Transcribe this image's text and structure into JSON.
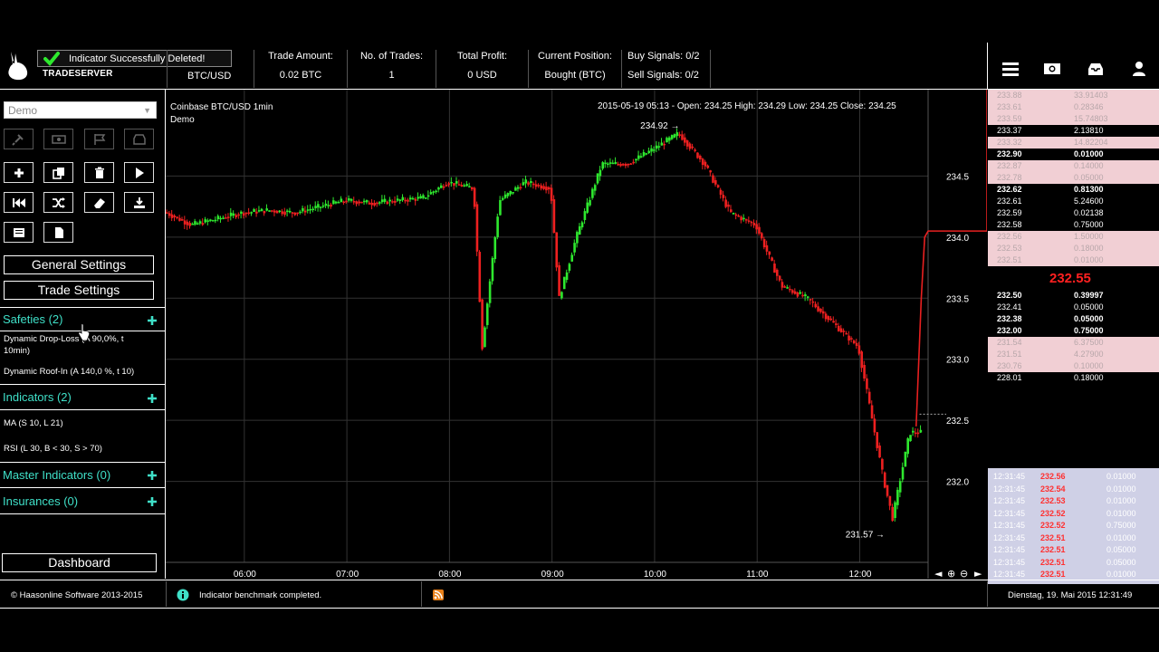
{
  "header": {
    "brand": "TRADESERVER",
    "toast": "Indicator Successfully Deleted!",
    "pair": "BTC/USD",
    "stats": [
      {
        "label": "Trade Amount:",
        "value": "0.02 BTC"
      },
      {
        "label": "No. of Trades:",
        "value": "1"
      },
      {
        "label": "Total Profit:",
        "value": "0 USD"
      },
      {
        "label": "Current Position:",
        "value": "Bought (BTC)"
      }
    ],
    "buy_signals": "Buy Signals: 0/2",
    "sell_signals": "Sell Signals: 0/2",
    "icons": [
      "menu-icon",
      "money-icon",
      "inbox-icon",
      "user-icon"
    ]
  },
  "sidebar": {
    "mode": "Demo",
    "general_settings": "General Settings",
    "trade_settings": "Trade Settings",
    "safeties_title": "Safeties (2)",
    "safeties": [
      "Dynamic Drop-Loss (A 90,0%, t 10min)",
      "Dynamic Roof-In (A 140,0 %, t 10)"
    ],
    "indicators_title": "Indicators (2)",
    "indicators": [
      "MA (S 10, L 21)",
      "RSI (L 30, B < 30, S > 70)"
    ],
    "master_title": "Master Indicators (0)",
    "insurances_title": "Insurances (0)",
    "dashboard": "Dashboard"
  },
  "chart": {
    "title": "Coinbase BTC/USD 1min",
    "subtitle": "Demo",
    "ohlc": "2015-05-19 05:13 - Open: 234.25 High: 234.29 Low: 234.25 Close: 234.25",
    "max_label": "234.92",
    "min_label": "231.57",
    "y_ticks": [
      "234.5",
      "234.0",
      "233.5",
      "233.0",
      "232.5",
      "232.0"
    ],
    "x_ticks": [
      "06:00",
      "07:00",
      "08:00",
      "09:00",
      "10:00",
      "11:00",
      "12:00"
    ],
    "colors": {
      "up": "#2ee82e",
      "down": "#ee2020",
      "line": "#e82020"
    }
  },
  "chart_data": {
    "type": "line",
    "title": "Coinbase BTC/USD 1min",
    "xlabel": "",
    "ylabel": "",
    "ylim": [
      231.5,
      235.0
    ],
    "x_ticks": [
      "06:00",
      "07:00",
      "08:00",
      "09:00",
      "10:00",
      "11:00",
      "12:00"
    ],
    "series": [
      {
        "x": [
          "05:00",
          "05:15",
          "05:30",
          "05:45",
          "06:00",
          "06:15",
          "06:30",
          "06:45",
          "07:00",
          "07:15",
          "07:30",
          "07:45",
          "08:00",
          "08:15",
          "08:20",
          "08:30",
          "08:45",
          "09:00",
          "09:05",
          "09:15",
          "09:30",
          "09:45",
          "10:00",
          "10:15",
          "10:30",
          "10:45",
          "11:00",
          "11:15",
          "11:30",
          "11:45",
          "12:00",
          "12:15",
          "12:20",
          "12:30"
        ],
        "values": [
          234.25,
          234.2,
          234.1,
          234.15,
          234.2,
          234.22,
          234.2,
          234.25,
          234.3,
          234.28,
          234.3,
          234.32,
          234.45,
          234.4,
          233.1,
          234.3,
          234.45,
          234.4,
          233.5,
          234.0,
          234.6,
          234.6,
          234.72,
          234.85,
          234.6,
          234.2,
          234.1,
          233.6,
          233.5,
          233.3,
          233.1,
          232.0,
          231.7,
          232.4
        ]
      }
    ]
  },
  "orderbook": {
    "mid": "232.55",
    "rows": [
      {
        "p": "233.88",
        "q": "33.91403",
        "k": "pink"
      },
      {
        "p": "233.61",
        "q": "0.28346",
        "k": "pink"
      },
      {
        "p": "233.59",
        "q": "15.74803",
        "k": "pink"
      },
      {
        "p": "233.37",
        "q": "2.13810",
        "k": "white"
      },
      {
        "p": "233.32",
        "q": "14.82204",
        "k": "pink"
      },
      {
        "p": "232.90",
        "q": "0.01000",
        "k": "white"
      },
      {
        "p": "232.87",
        "q": "0.14000",
        "k": "pink"
      },
      {
        "p": "232.78",
        "q": "0.05000",
        "k": "pink"
      },
      {
        "p": "232.62",
        "q": "0.81300",
        "k": "white"
      },
      {
        "p": "232.61",
        "q": "5.24600",
        "k": "white"
      },
      {
        "p": "232.59",
        "q": "0.02138",
        "k": "white"
      },
      {
        "p": "232.58",
        "q": "0.75000",
        "k": "white"
      },
      {
        "p": "232.56",
        "q": "1.50000",
        "k": "pink"
      },
      {
        "p": "232.53",
        "q": "0.18000",
        "k": "pink"
      },
      {
        "p": "232.51",
        "q": "0.01000",
        "k": "pink"
      },
      {
        "p": "232.50",
        "q": "0.39997",
        "k": "white"
      },
      {
        "p": "232.41",
        "q": "0.05000",
        "k": "white"
      },
      {
        "p": "232.38",
        "q": "0.05000",
        "k": "white"
      },
      {
        "p": "232.00",
        "q": "0.75000",
        "k": "white"
      },
      {
        "p": "231.54",
        "q": "6.37500",
        "k": "pink"
      },
      {
        "p": "231.51",
        "q": "4.27900",
        "k": "pink"
      },
      {
        "p": "230.76",
        "q": "0.10000",
        "k": "pink"
      },
      {
        "p": "228.01",
        "q": "0.18000",
        "k": "white"
      }
    ],
    "trades": [
      {
        "t": "12:31:45",
        "p": "232.56",
        "a": "0.01000"
      },
      {
        "t": "12:31:45",
        "p": "232.54",
        "a": "0.01000"
      },
      {
        "t": "12:31:45",
        "p": "232.53",
        "a": "0.01000"
      },
      {
        "t": "12:31:45",
        "p": "232.52",
        "a": "0.01000"
      },
      {
        "t": "12:31:45",
        "p": "232.52",
        "a": "0.75000"
      },
      {
        "t": "12:31:45",
        "p": "232.51",
        "a": "0.01000"
      },
      {
        "t": "12:31:45",
        "p": "232.51",
        "a": "0.05000"
      },
      {
        "t": "12:31:45",
        "p": "232.51",
        "a": "0.05000"
      },
      {
        "t": "12:31:45",
        "p": "232.51",
        "a": "0.01000"
      }
    ]
  },
  "footer": {
    "copyright": "© Haasonline Software 2013-2015",
    "status": "Indicator benchmark completed.",
    "datetime": "Dienstag, 19. Mai 2015 12:31:49"
  }
}
